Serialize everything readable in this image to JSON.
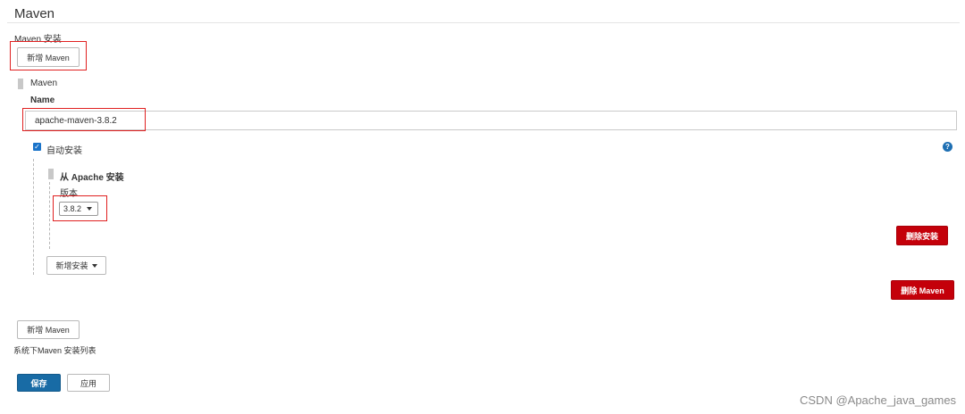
{
  "section": {
    "title": "Maven"
  },
  "installations": {
    "label": "Maven 安装",
    "add_button": "新增 Maven",
    "list_label": "系统下Maven 安装列表"
  },
  "maven_item": {
    "title": "Maven",
    "name_label": "Name",
    "name_value": "apache-maven-3.8.2",
    "auto_install_label": "自动安装",
    "auto_install_checked": true,
    "help_glyph": "?",
    "delete_button": "删除 Maven"
  },
  "installer": {
    "title": "从 Apache 安装",
    "version_label": "版本",
    "version_value": "3.8.2",
    "delete_button": "删除安装",
    "add_installer_button": "新增安装"
  },
  "actions": {
    "save": "保存",
    "apply": "应用"
  },
  "watermark": "CSDN @Apache_java_games",
  "colors": {
    "danger": "#c4000a",
    "primary": "#186ba5",
    "highlight": "#e02020",
    "checkbox": "#1a73c9"
  },
  "icons": [
    "drag-handle-icon",
    "checkbox-checked-icon",
    "help-icon",
    "dropdown-caret-icon"
  ]
}
